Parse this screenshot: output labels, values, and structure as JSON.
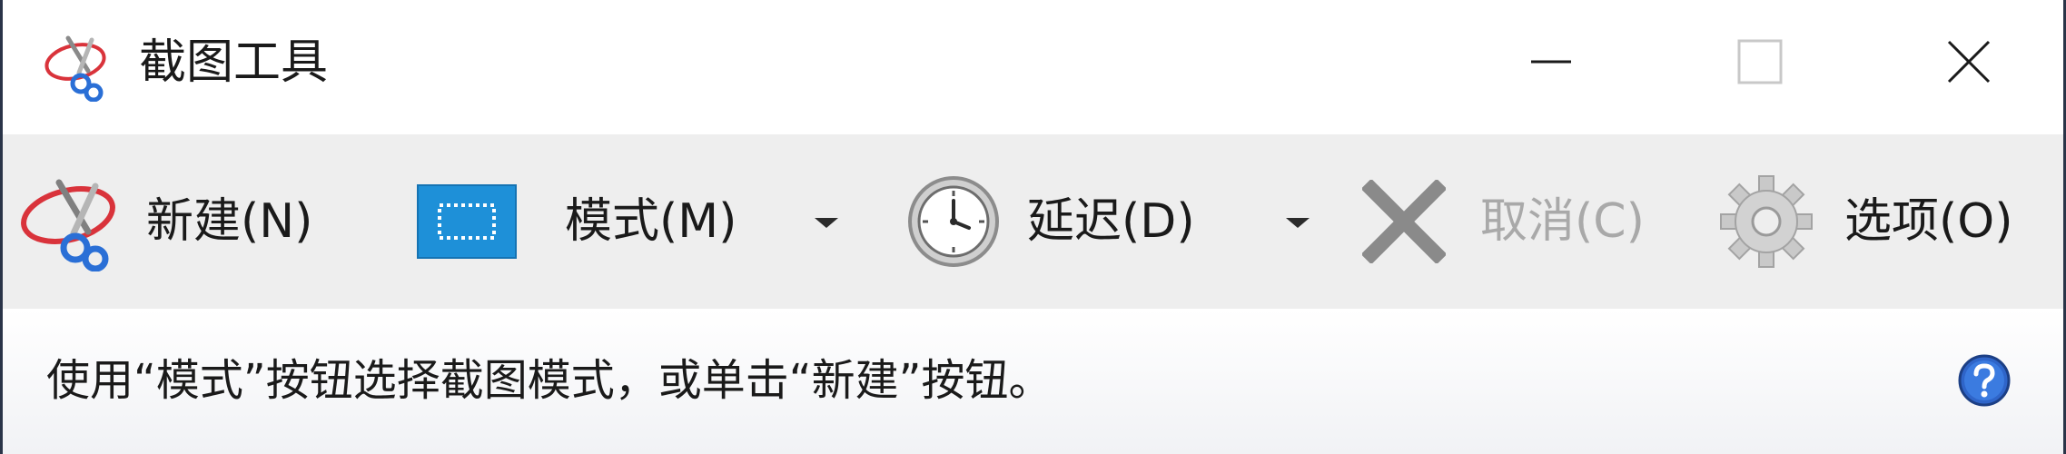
{
  "window": {
    "title": "截图工具"
  },
  "toolbar": {
    "new_label": "新建(N)",
    "mode_label": "模式(M)",
    "delay_label": "延迟(D)",
    "cancel_label": "取消(C)",
    "options_label": "选项(O)"
  },
  "status": {
    "message": "使用“模式”按钮选择截图模式，或单击“新建”按钮。"
  },
  "icons": {
    "app": "scissors-icon",
    "new": "scissors-icon",
    "mode": "rectangle-snip-icon",
    "delay": "clock-icon",
    "cancel": "x-icon",
    "options": "gear-icon",
    "help": "help-icon"
  },
  "colors": {
    "toolbar_bg": "#eeeeee",
    "accent_blue": "#1e90d8",
    "scissors_red": "#d9333b",
    "scissors_blue": "#2a6fd6",
    "disabled_text": "#a9a9a9"
  }
}
